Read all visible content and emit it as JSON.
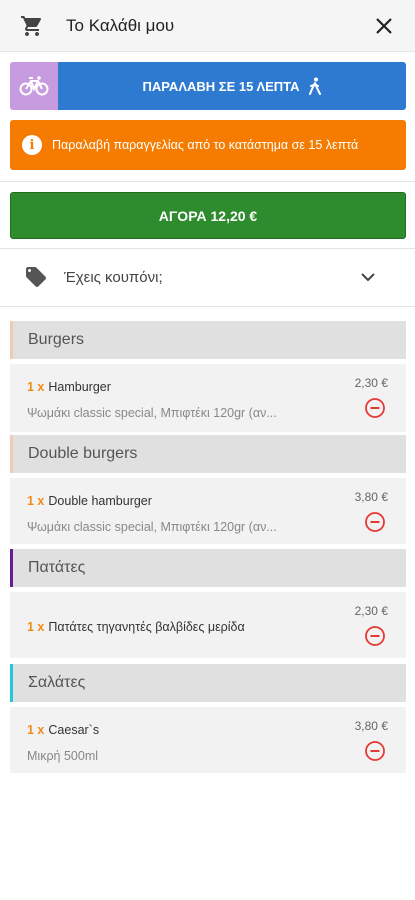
{
  "header": {
    "title": "Το Καλάθι μου",
    "cart_icon": "cart-icon",
    "close_icon": "close-icon"
  },
  "pickup": {
    "label": "ΠΑΡΑΛΑΒΗ  ΣΕ 15 ΛΕΠΤΑ",
    "toggle_icon": "bicycle-icon",
    "walk_icon": "walking-icon",
    "toggle_color": "#c79be0",
    "main_color": "#2f7ad1"
  },
  "notice": {
    "text": "Παραλαβή παραγγελίας από το κατάστημα σε 15 λεπτά",
    "color": "#f57c00"
  },
  "buy": {
    "label": "ΑΓΟΡΑ 12,20 €",
    "color": "#2e8b2e"
  },
  "coupon": {
    "label": "Έχεις κουπόνι;"
  },
  "categories": [
    {
      "name": "Burgers",
      "accent": "#f3c9b5",
      "items": [
        {
          "qty": "1 x",
          "name": "Hamburger",
          "desc": "Ψωμάκι classic special, Μπιφτέκι 120gr (αν...",
          "price": "2,30 €"
        }
      ]
    },
    {
      "name": "Double burgers",
      "accent": "#f3c9b5",
      "items": [
        {
          "qty": "1 x",
          "name": "Double hamburger",
          "desc": "Ψωμάκι classic special, Μπιφτέκι 120gr (αν...",
          "price": "3,80 €"
        }
      ]
    },
    {
      "name": "Πατάτες",
      "accent": "#6a1b9a",
      "items": [
        {
          "qty": "1 x",
          "name": "Πατάτες τηγανητές βαλβίδες μερίδα",
          "desc": "",
          "price": "2,30 €"
        }
      ]
    },
    {
      "name": "Σαλάτες",
      "accent": "#26c6da",
      "items": [
        {
          "qty": "1 x",
          "name": "Caesar`s",
          "desc": "Μικρή 500ml",
          "price": "3,80 €"
        }
      ]
    }
  ]
}
